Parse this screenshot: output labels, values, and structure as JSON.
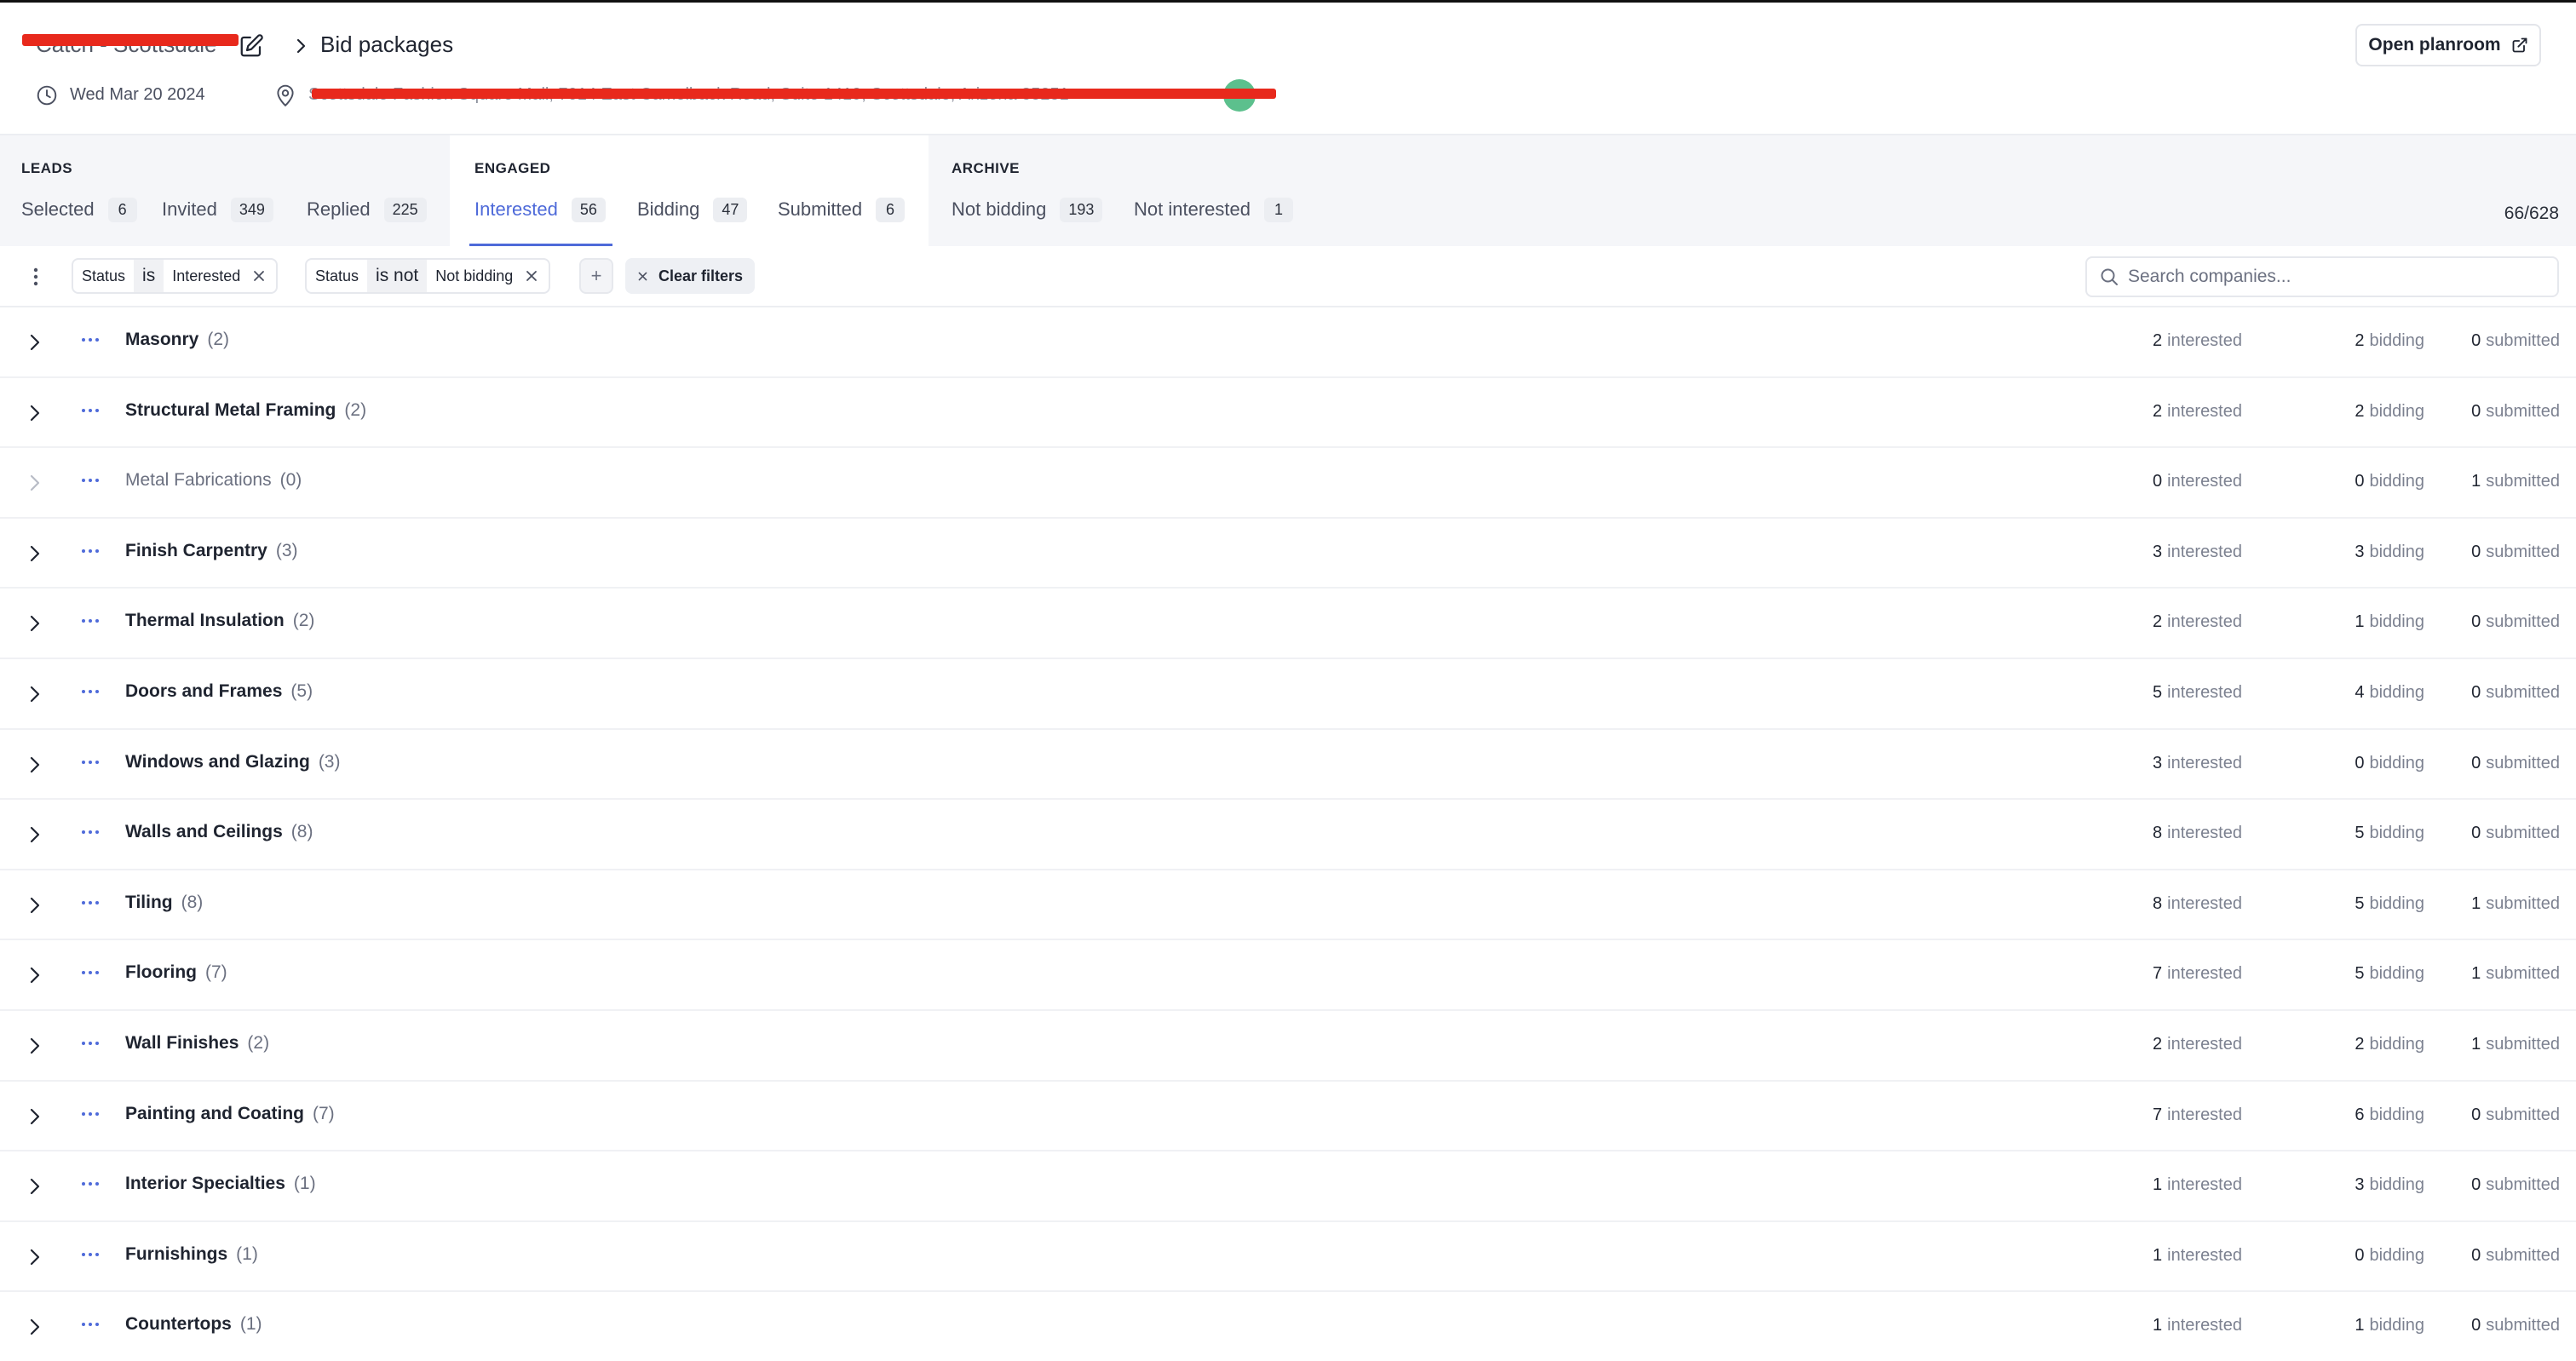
{
  "header": {
    "project_name": "Catch - Scottsdale",
    "current_page": "Bid packages",
    "date": "Wed Mar 20 2024",
    "address": "Scottsdale Fashion Square Mall, 7014 East Camelback Road, Suite 1419, Scottsdale, Arizona 85251",
    "open_planroom_label": "Open planroom"
  },
  "tab_groups": {
    "leads": {
      "title": "LEADS",
      "tabs": [
        {
          "label": "Selected",
          "count": "6"
        },
        {
          "label": "Invited",
          "count": "349"
        },
        {
          "label": "Replied",
          "count": "225"
        }
      ]
    },
    "engaged": {
      "title": "ENGAGED",
      "tabs": [
        {
          "label": "Interested",
          "count": "56"
        },
        {
          "label": "Bidding",
          "count": "47"
        },
        {
          "label": "Submitted",
          "count": "6"
        }
      ]
    },
    "archive": {
      "title": "ARCHIVE",
      "tabs": [
        {
          "label": "Not bidding",
          "count": "193"
        },
        {
          "label": "Not interested",
          "count": "1"
        }
      ]
    },
    "active_tab": "Interested",
    "total": "66/628"
  },
  "filters": [
    {
      "field": "Status",
      "operator": "is",
      "value": "Interested"
    },
    {
      "field": "Status",
      "operator": "is not",
      "value": "Not bidding"
    }
  ],
  "filter_actions": {
    "add_label": "+",
    "clear_label": "Clear filters"
  },
  "search": {
    "placeholder": "Search companies..."
  },
  "stat_labels": {
    "interested": "interested",
    "bidding": "bidding",
    "submitted": "submitted"
  },
  "packages": [
    {
      "name": "Masonry",
      "count": "(2)",
      "interested": "2",
      "bidding": "2",
      "submitted": "0",
      "enabled": true
    },
    {
      "name": "Structural Metal Framing",
      "count": "(2)",
      "interested": "2",
      "bidding": "2",
      "submitted": "0",
      "enabled": true
    },
    {
      "name": "Metal Fabrications",
      "count": "(0)",
      "interested": "0",
      "bidding": "0",
      "submitted": "1",
      "enabled": false
    },
    {
      "name": "Finish Carpentry",
      "count": "(3)",
      "interested": "3",
      "bidding": "3",
      "submitted": "0",
      "enabled": true
    },
    {
      "name": "Thermal Insulation",
      "count": "(2)",
      "interested": "2",
      "bidding": "1",
      "submitted": "0",
      "enabled": true
    },
    {
      "name": "Doors and Frames",
      "count": "(5)",
      "interested": "5",
      "bidding": "4",
      "submitted": "0",
      "enabled": true
    },
    {
      "name": "Windows and Glazing",
      "count": "(3)",
      "interested": "3",
      "bidding": "0",
      "submitted": "0",
      "enabled": true
    },
    {
      "name": "Walls and Ceilings",
      "count": "(8)",
      "interested": "8",
      "bidding": "5",
      "submitted": "0",
      "enabled": true
    },
    {
      "name": "Tiling",
      "count": "(8)",
      "interested": "8",
      "bidding": "5",
      "submitted": "1",
      "enabled": true
    },
    {
      "name": "Flooring",
      "count": "(7)",
      "interested": "7",
      "bidding": "5",
      "submitted": "1",
      "enabled": true
    },
    {
      "name": "Wall Finishes",
      "count": "(2)",
      "interested": "2",
      "bidding": "2",
      "submitted": "1",
      "enabled": true
    },
    {
      "name": "Painting and Coating",
      "count": "(7)",
      "interested": "7",
      "bidding": "6",
      "submitted": "0",
      "enabled": true
    },
    {
      "name": "Interior Specialties",
      "count": "(1)",
      "interested": "1",
      "bidding": "3",
      "submitted": "0",
      "enabled": true
    },
    {
      "name": "Furnishings",
      "count": "(1)",
      "interested": "1",
      "bidding": "0",
      "submitted": "0",
      "enabled": true
    },
    {
      "name": "Countertops",
      "count": "(1)",
      "interested": "1",
      "bidding": "1",
      "submitted": "0",
      "enabled": true
    }
  ],
  "colors": {
    "accent": "#4e6ad9",
    "redaction": "#e8291c",
    "avatar": "#5cc08d"
  },
  "icons": {
    "edit": "edit-icon",
    "breadcrumb_separator": "chevron-right-icon",
    "date": "clock-icon",
    "location": "map-pin-icon",
    "external": "external-link-icon",
    "menu": "kebab-icon",
    "remove_filter": "close-icon",
    "search": "search-icon",
    "row_expand": "chevron-right-icon",
    "row_actions": "more-horizontal-icon"
  }
}
